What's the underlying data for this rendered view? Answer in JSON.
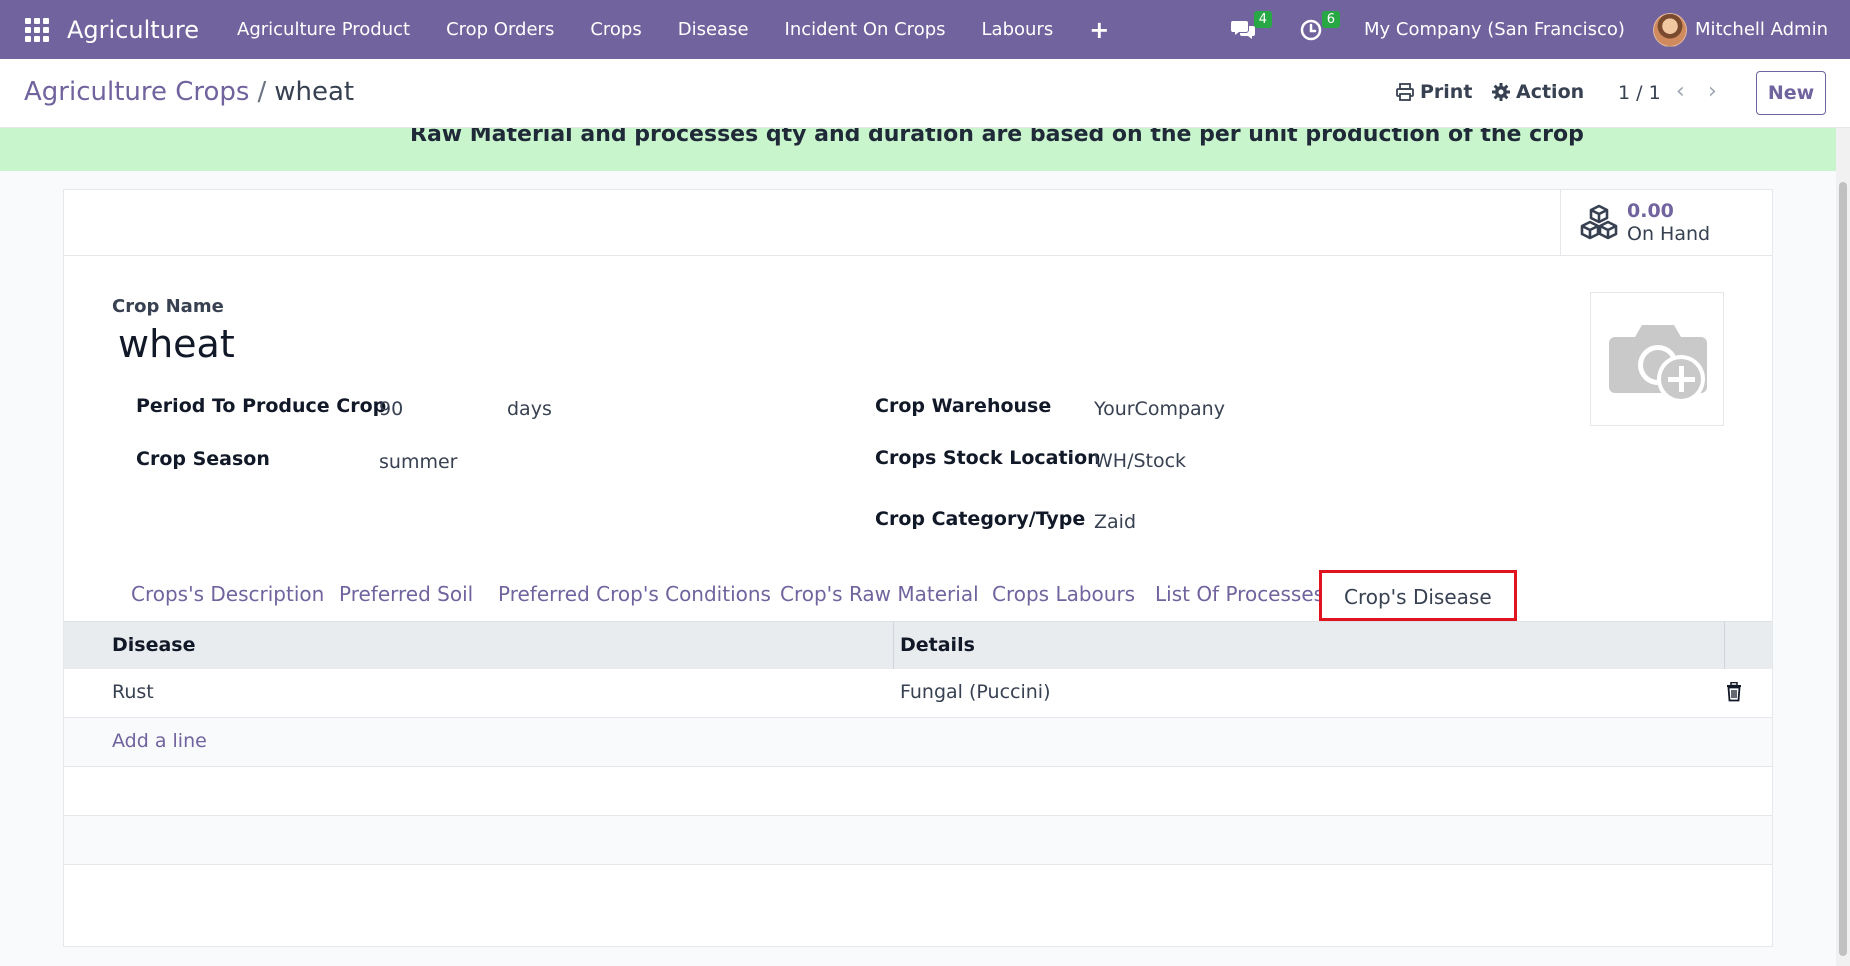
{
  "navbar": {
    "app_name": "Agriculture",
    "menu": [
      "Agriculture Product",
      "Crop Orders",
      "Crops",
      "Disease",
      "Incident On Crops",
      "Labours"
    ],
    "plus_label": "+",
    "messages_count": "4",
    "activities_count": "6",
    "company": "My Company (San Francisco)",
    "user": "Mitchell Admin"
  },
  "control": {
    "breadcrumb_parent": "Agriculture Crops",
    "breadcrumb_sep": "/",
    "breadcrumb_current": "wheat",
    "print_label": "Print",
    "action_label": "Action",
    "pager": "1 / 1",
    "new_label": "New"
  },
  "alert": {
    "text": "Raw Material and processes qty and duration are based on the per unit production of the crop"
  },
  "stat": {
    "value": "0.00",
    "label": "On Hand"
  },
  "form": {
    "crop_name_label": "Crop Name",
    "crop_name": "wheat",
    "period_label": "Period To Produce Crop",
    "period_value": "90",
    "period_unit": "days",
    "season_label": "Crop Season",
    "season_value": "summer",
    "warehouse_label": "Crop Warehouse",
    "warehouse_value": "YourCompany",
    "stock_label": "Crops Stock Location",
    "stock_value": "WH/Stock",
    "category_label": "Crop Category/Type",
    "category_value": "Zaid"
  },
  "tabs": [
    "Crops's Description",
    "Preferred Soil",
    "Preferred Crop's Conditions",
    "Crop's Raw Material",
    "Crops Labours",
    "List Of Processes",
    "Crop's Disease"
  ],
  "table": {
    "headers": [
      "Disease",
      "Details"
    ],
    "rows": [
      {
        "disease": "Rust",
        "details": "Fungal (Puccini)"
      }
    ],
    "add_line": "Add a line"
  },
  "colors": {
    "brand": "#71639e",
    "alert_bg": "#c9f5cd",
    "highlight": "#e0141e"
  }
}
